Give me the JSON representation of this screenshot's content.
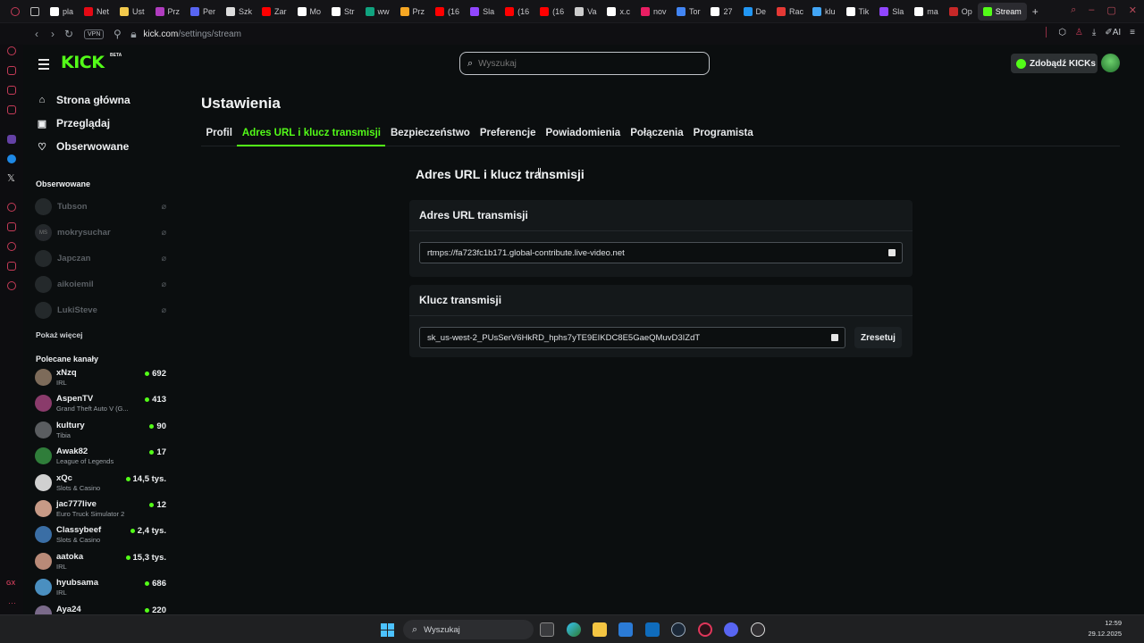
{
  "browser": {
    "tabs": [
      {
        "label": "pla",
        "color": "#ffffff"
      },
      {
        "label": "Net",
        "color": "#e50914"
      },
      {
        "label": "Ust",
        "color": "#f2c94c"
      },
      {
        "label": "Prz",
        "color": "#b03cbf"
      },
      {
        "label": "Per",
        "color": "#5865f2"
      },
      {
        "label": "Szk",
        "color": "#dddddd"
      },
      {
        "label": "Zar",
        "color": "#ff0000"
      },
      {
        "label": "Mo",
        "color": "#ffffff"
      },
      {
        "label": "Str",
        "color": "#ffffff"
      },
      {
        "label": "ww",
        "color": "#10a37f"
      },
      {
        "label": "Prz",
        "color": "#f5a623"
      },
      {
        "label": "(16",
        "color": "#ff0000"
      },
      {
        "label": "Sla",
        "color": "#9146ff"
      },
      {
        "label": "(16",
        "color": "#ff0000"
      },
      {
        "label": "(16",
        "color": "#ff0000"
      },
      {
        "label": "Va",
        "color": "#cccccc"
      },
      {
        "label": "x.c",
        "color": "#ffffff"
      },
      {
        "label": "nov",
        "color": "#e91e63"
      },
      {
        "label": "Tor",
        "color": "#4285f4"
      },
      {
        "label": "27",
        "color": "#ffffff"
      },
      {
        "label": "De",
        "color": "#2196f3"
      },
      {
        "label": "Rac",
        "color": "#e53935"
      },
      {
        "label": "klu",
        "color": "#42a5f5"
      },
      {
        "label": "Tik",
        "color": "#ffffff"
      },
      {
        "label": "Sla",
        "color": "#9146ff"
      },
      {
        "label": "ma",
        "color": "#ffffff"
      },
      {
        "label": "Op",
        "color": "#c62828"
      }
    ],
    "active_tab": {
      "label": "Stream",
      "color": "#53fc18"
    },
    "vpn": "VPN",
    "url_host": "kick.com",
    "url_path": "/settings/stream",
    "ai_label": "AI"
  },
  "header": {
    "logo": "KICK",
    "beta": "BETA",
    "search_placeholder": "Wyszukaj",
    "kicks_button": "Zdobądź KICKs"
  },
  "nav": {
    "items": [
      {
        "label": "Strona główna",
        "icon": "home-icon",
        "glyph": "⌂"
      },
      {
        "label": "Przeglądaj",
        "icon": "browse-icon",
        "glyph": "▣"
      },
      {
        "label": "Obserwowane",
        "icon": "heart-icon",
        "glyph": "♡"
      }
    ],
    "following_title": "Obserwowane",
    "following": [
      {
        "name": "Tubson",
        "initials": ""
      },
      {
        "name": "mokrysuchar",
        "initials": "MS"
      },
      {
        "name": "Japczan",
        "initials": ""
      },
      {
        "name": "aikoiemil",
        "initials": ""
      },
      {
        "name": "LukiSteve",
        "initials": ""
      }
    ],
    "show_more": "Pokaż więcej",
    "recommended_title": "Polecane kanały",
    "recommended": [
      {
        "name": "xNzq",
        "category": "IRL",
        "viewers": "692",
        "color": "#7d6b5a"
      },
      {
        "name": "AspenTV",
        "category": "Grand Theft Auto V (G...",
        "viewers": "413",
        "color": "#8a3b6b"
      },
      {
        "name": "kultury",
        "category": "Tibia",
        "viewers": "90",
        "color": "#5a5d60"
      },
      {
        "name": "Awak82",
        "category": "League of Legends",
        "viewers": "17",
        "color": "#2f7d3a"
      },
      {
        "name": "xQc",
        "category": "Slots & Casino",
        "viewers": "14,5 tys.",
        "color": "#d0d0d0"
      },
      {
        "name": "jac777live",
        "category": "Euro Truck Simulator 2",
        "viewers": "12",
        "color": "#c79a86"
      },
      {
        "name": "Classybeef",
        "category": "Slots & Casino",
        "viewers": "2,4 tys.",
        "color": "#3a6ea5"
      },
      {
        "name": "aatoka",
        "category": "IRL",
        "viewers": "15,3 tys.",
        "color": "#b98a78"
      },
      {
        "name": "hyubsama",
        "category": "IRL",
        "viewers": "686",
        "color": "#4a8fc0"
      },
      {
        "name": "Aya24",
        "category": "",
        "viewers": "220",
        "color": "#7a6a8a"
      }
    ]
  },
  "main": {
    "title": "Ustawienia",
    "tabs": [
      "Profil",
      "Adres URL i klucz transmisji",
      "Bezpieczeństwo",
      "Preferencje",
      "Powiadomienia",
      "Połączenia",
      "Programista"
    ],
    "active_tab_index": 1,
    "section_title": "Adres URL i klucz transmisji",
    "url_card": {
      "title": "Adres URL transmisji",
      "value": "rtmps://fa723fc1b171.global-contribute.live-video.net"
    },
    "key_card": {
      "title": "Klucz transmisji",
      "value": "sk_us-west-2_PUsSerV6HkRD_hphs7yTE9EIKDC8E5GaeQMuvD3IZdT",
      "reset_label": "Zresetuj"
    }
  },
  "taskbar": {
    "search_placeholder": "Wyszukaj",
    "time": "12:59",
    "date": "29.12.2025"
  },
  "colors": {
    "accent": "#53fc18",
    "background": "#0b0e0f",
    "card": "#14181a"
  }
}
